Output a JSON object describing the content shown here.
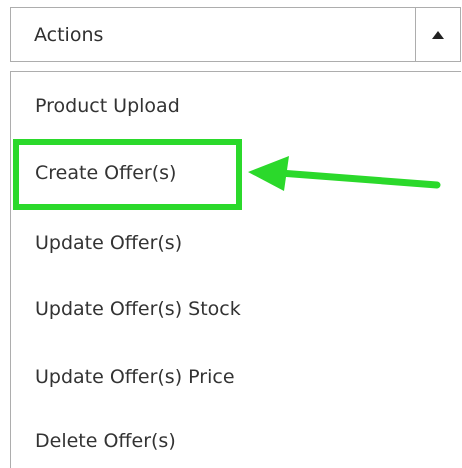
{
  "actions_select": {
    "label": "Actions"
  },
  "menu": {
    "items": [
      {
        "label": "Product Upload"
      },
      {
        "label": "Create Offer(s)"
      },
      {
        "label": "Update Offer(s)"
      },
      {
        "label": "Update Offer(s) Stock"
      },
      {
        "label": "Update Offer(s) Price"
      },
      {
        "label": "Delete Offer(s)"
      }
    ]
  },
  "annotation": {
    "highlight_color": "#2bd92b",
    "highlighted_item": "Create Offer(s)"
  },
  "icons": {
    "toggle": "caret-up-icon",
    "annotation": "arrow-left-icon"
  }
}
